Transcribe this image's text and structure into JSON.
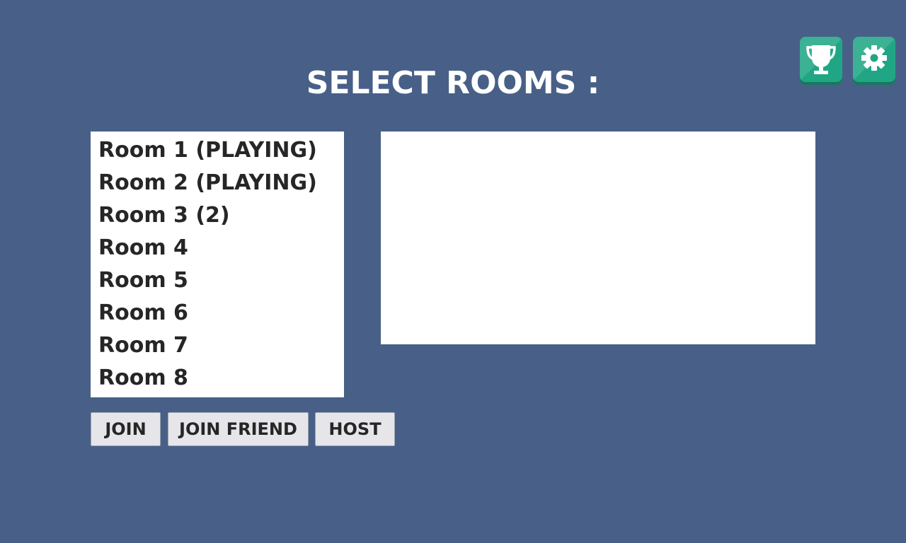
{
  "header": {
    "title": "SELECT ROOMS :",
    "trophy_icon": "trophy-icon",
    "settings_icon": "gear-icon"
  },
  "rooms": [
    {
      "label": "Room 1 (PLAYING)"
    },
    {
      "label": "Room 2 (PLAYING)"
    },
    {
      "label": "Room 3 (2)"
    },
    {
      "label": "Room 4"
    },
    {
      "label": "Room 5"
    },
    {
      "label": "Room 6"
    },
    {
      "label": "Room 7"
    },
    {
      "label": "Room 8"
    }
  ],
  "info_panel": {
    "text": ""
  },
  "actions": {
    "join_label": "JOIN",
    "join_friend_label": "JOIN FRIEND",
    "host_label": "HOST"
  },
  "colors": {
    "background": "#486087",
    "accent": "#21a685",
    "panel": "#ffffff",
    "button": "#e6e6ea"
  }
}
